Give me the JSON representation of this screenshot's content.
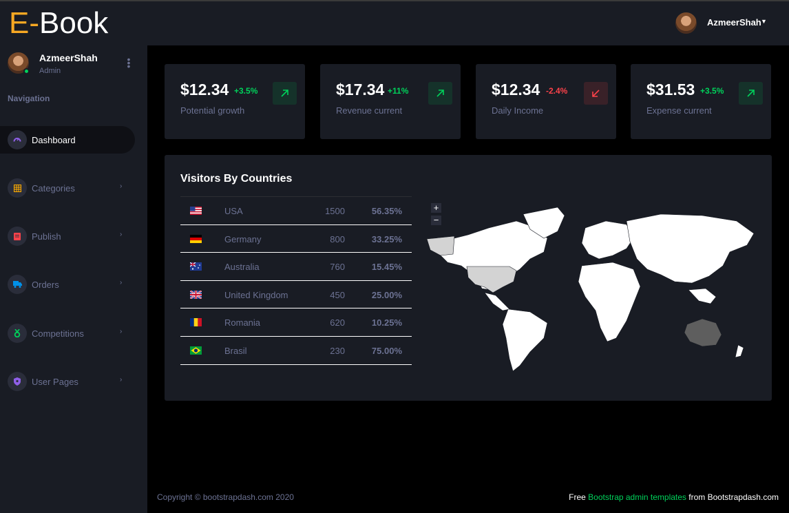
{
  "brand": {
    "prefix": "E-",
    "rest": "Book"
  },
  "sidebar": {
    "profile": {
      "name": "AzmeerShah",
      "role": "Admin"
    },
    "nav_title": "Navigation",
    "items": [
      {
        "label": "Dashboard",
        "icon": "speedometer-icon",
        "icon_color": "#8f5fe8",
        "active": true
      },
      {
        "label": "Categories",
        "icon": "grid-icon",
        "icon_color": "#ffab00"
      },
      {
        "label": "Publish",
        "icon": "document-icon",
        "icon_color": "#fc424a"
      },
      {
        "label": "Orders",
        "icon": "truck-icon",
        "icon_color": "#0090e7"
      },
      {
        "label": "Competitions",
        "icon": "medal-icon",
        "icon_color": "#00d25b"
      },
      {
        "label": "User Pages",
        "icon": "shield-icon",
        "icon_color": "#8f5fe8"
      }
    ]
  },
  "topbar": {
    "user": "AzmeerShah"
  },
  "stats": [
    {
      "value": "$12.34",
      "change": "+3.5%",
      "trend": "up",
      "label": "Potential growth"
    },
    {
      "value": "$17.34",
      "change": "+11%",
      "trend": "up",
      "label": "Revenue current"
    },
    {
      "value": "$12.34",
      "change": "-2.4%",
      "trend": "down",
      "label": "Daily Income"
    },
    {
      "value": "$31.53",
      "change": "+3.5%",
      "trend": "up",
      "label": "Expense current"
    }
  ],
  "visitors": {
    "title": "Visitors By Countries",
    "rows": [
      {
        "flag": "us-flag-icon",
        "country": "USA",
        "count": "1500",
        "pct": "56.35%"
      },
      {
        "flag": "de-flag-icon",
        "country": "Germany",
        "count": "800",
        "pct": "33.25%"
      },
      {
        "flag": "au-flag-icon",
        "country": "Australia",
        "count": "760",
        "pct": "15.45%"
      },
      {
        "flag": "gb-flag-icon",
        "country": "United Kingdom",
        "count": "450",
        "pct": "25.00%"
      },
      {
        "flag": "ro-flag-icon",
        "country": "Romania",
        "count": "620",
        "pct": "10.25%"
      },
      {
        "flag": "br-flag-icon",
        "country": "Brasil",
        "count": "230",
        "pct": "75.00%"
      }
    ],
    "zoom_in": "+",
    "zoom_out": "−"
  },
  "footer": {
    "copyright": "Copyright © bootstrapdash.com 2020",
    "free": "Free",
    "link": "Bootstrap admin templates",
    "from": "from Bootstrapdash.com"
  },
  "colors": {
    "accent": "#f7a823",
    "success": "#00d25b",
    "danger": "#fc424a",
    "muted": "#6c7293",
    "panel": "#191c24"
  }
}
